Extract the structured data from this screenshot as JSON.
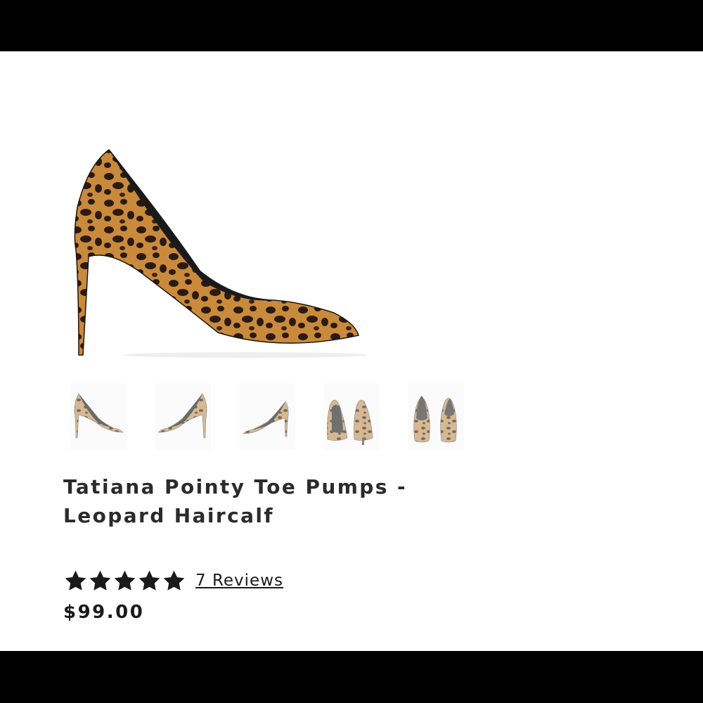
{
  "product": {
    "title_line1": "Tatiana Pointy Toe Pumps -",
    "title_line2": "Leopard Haircalf",
    "rating": 5,
    "reviews_label": "7 Reviews",
    "price": "$99.00"
  },
  "gallery": {
    "main_image": "leopard-pump-side-view",
    "thumbnails": [
      {
        "name": "thumb-side-left"
      },
      {
        "name": "thumb-side-right"
      },
      {
        "name": "thumb-side-right-alt"
      },
      {
        "name": "thumb-back-pair"
      },
      {
        "name": "thumb-front-pair"
      }
    ]
  },
  "colors": {
    "leopard_base": "#c98a3c",
    "spot": "#2a1a10",
    "frame": "#000000",
    "text": "#2b2b2b"
  }
}
